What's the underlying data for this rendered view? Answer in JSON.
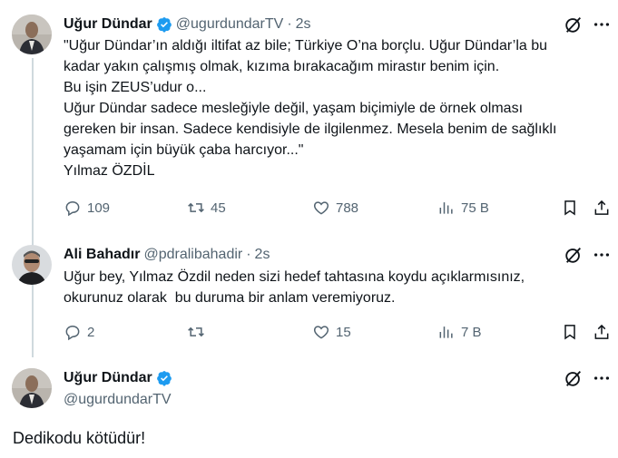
{
  "colors": {
    "text": "#0f1419",
    "secondary": "#536471",
    "verified": "#1d9bf0",
    "thread_line": "#cfd9de"
  },
  "tweet1": {
    "name": "Uğur Dündar",
    "handle": "@ugurdundarTV",
    "time": "2s",
    "lines": [
      "\"Uğur Dündar’ın aldığı iltifat az bile; Türkiye O’na borçlu. Uğur Dündar’la bu",
      "kadar yakın çalışmış olmak, kızıma bırakacağım mirastır benim için.",
      "Bu işin ZEUS’udur o...",
      "Uğur Dündar sadece mesleğiyle değil, yaşam biçimiyle de örnek olması",
      "gereken bir insan. Sadece kendisiyle de ilgilenmez. Mesela benim de sağlıklı",
      "yaşamam için büyük çaba harcıyor...\"",
      "Yılmaz ÖZDİL"
    ],
    "stats": {
      "replies": "109",
      "reposts": "45",
      "likes": "788",
      "views": "75 B"
    }
  },
  "tweet2": {
    "name": "Ali Bahadır",
    "handle": "@pdralibahadir",
    "time": "2s",
    "lines": [
      "Uğur bey, Yılmaz Özdil neden sizi hedef tahtasına koydu açıklarmısınız,",
      "okurunuz olarak  bu duruma bir anlam veremiyoruz."
    ],
    "stats": {
      "replies": "2",
      "reposts": "",
      "likes": "15",
      "views": "7 B"
    }
  },
  "tweet3": {
    "name": "Uğur Dündar",
    "handle": "@ugurdundarTV",
    "text": "Dedikodu kötüdür!"
  },
  "icons": {
    "verified": "verified-badge-icon",
    "grok": "grok-icon",
    "more": "more-icon",
    "reply": "reply-icon",
    "repost": "repost-icon",
    "like": "like-icon",
    "views": "views-icon",
    "bookmark": "bookmark-icon",
    "share": "share-icon"
  }
}
